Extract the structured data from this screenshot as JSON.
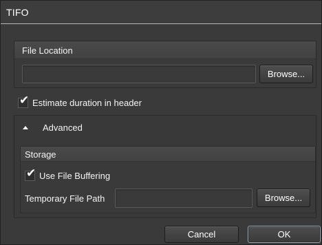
{
  "window": {
    "title": "TIFO"
  },
  "file_location": {
    "title": "File Location",
    "path_value": "",
    "browse_label": "Browse..."
  },
  "estimate_duration": {
    "label": "Estimate duration in header",
    "checked": true
  },
  "advanced": {
    "label": "Advanced",
    "expanded": true,
    "storage": {
      "title": "Storage",
      "use_file_buffering": {
        "label": "Use File Buffering",
        "checked": true
      },
      "temp_path_label": "Temporary File Path",
      "temp_path_value": "",
      "browse_label": "Browse..."
    }
  },
  "footer": {
    "cancel_label": "Cancel",
    "ok_label": "OK"
  },
  "check_glyph": "✔",
  "icons": {
    "expander": "chevron-up-icon",
    "checkmark": "checkmark-icon"
  }
}
